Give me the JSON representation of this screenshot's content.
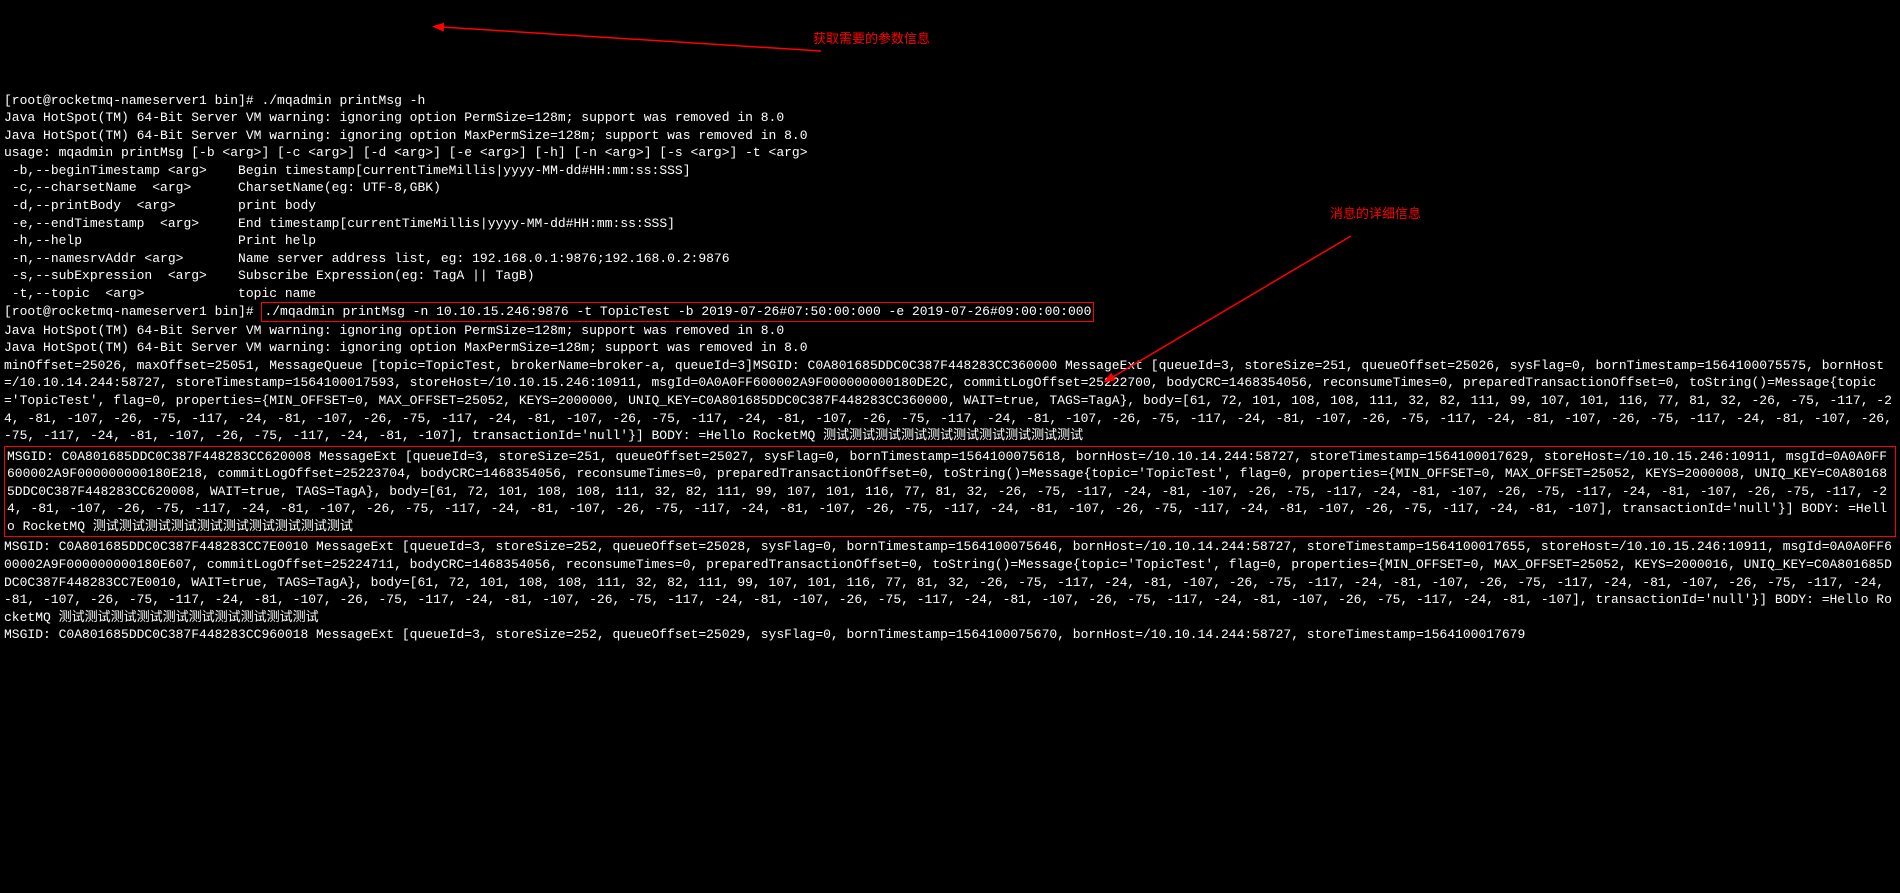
{
  "prompt1": {
    "userhost": "[root@rocketmq-nameserver1 bin]# ",
    "cmd": "./mqadmin printMsg -h"
  },
  "warn1": "Java HotSpot(TM) 64-Bit Server VM warning: ignoring option PermSize=128m; support was removed in 8.0",
  "warn2": "Java HotSpot(TM) 64-Bit Server VM warning: ignoring option MaxPermSize=128m; support was removed in 8.0",
  "usage": "usage: mqadmin printMsg [-b <arg>] [-c <arg>] [-d <arg>] [-e <arg>] [-h] [-n <arg>] [-s <arg>] -t <arg>",
  "opts": {
    "b": " -b,--beginTimestamp <arg>    Begin timestamp[currentTimeMillis|yyyy-MM-dd#HH:mm:ss:SSS]",
    "c": " -c,--charsetName  <arg>      CharsetName(eg: UTF-8,GBK)",
    "d": " -d,--printBody  <arg>        print body",
    "e": " -e,--endTimestamp  <arg>     End timestamp[currentTimeMillis|yyyy-MM-dd#HH:mm:ss:SSS]",
    "h": " -h,--help                    Print help",
    "n": " -n,--namesrvAddr <arg>       Name server address list, eg: 192.168.0.1:9876;192.168.0.2:9876",
    "s": " -s,--subExpression  <arg>    Subscribe Expression(eg: TagA || TagB)",
    "t": " -t,--topic  <arg>            topic name"
  },
  "prompt2": {
    "userhost": "[root@rocketmq-nameserver1 bin]# ",
    "cmd": "./mqadmin printMsg -n 10.10.15.246:9876 -t TopicTest -b 2019-07-26#07:50:00:000 -e 2019-07-26#09:00:00:000"
  },
  "warn3": "Java HotSpot(TM) 64-Bit Server VM warning: ignoring option PermSize=128m; support was removed in 8.0",
  "warn4": "Java HotSpot(TM) 64-Bit Server VM warning: ignoring option MaxPermSize=128m; support was removed in 8.0",
  "msg1": "minOffset=25026, maxOffset=25051, MessageQueue [topic=TopicTest, brokerName=broker-a, queueId=3]MSGID: C0A801685DDC0C387F448283CC360000 MessageExt [queueId=3, storeSize=251, queueOffset=25026, sysFlag=0, bornTimestamp=1564100075575, bornHost=/10.10.14.244:58727, storeTimestamp=1564100017593, storeHost=/10.10.15.246:10911, msgId=0A0A0FF600002A9F000000000180DE2C, commitLogOffset=25222700, bodyCRC=1468354056, reconsumeTimes=0, preparedTransactionOffset=0, toString()=Message{topic='TopicTest', flag=0, properties={MIN_OFFSET=0, MAX_OFFSET=25052, KEYS=2000000, UNIQ_KEY=C0A801685DDC0C387F448283CC360000, WAIT=true, TAGS=TagA}, body=[61, 72, 101, 108, 108, 111, 32, 82, 111, 99, 107, 101, 116, 77, 81, 32, -26, -75, -117, -24, -81, -107, -26, -75, -117, -24, -81, -107, -26, -75, -117, -24, -81, -107, -26, -75, -117, -24, -81, -107, -26, -75, -117, -24, -81, -107, -26, -75, -117, -24, -81, -107, -26, -75, -117, -24, -81, -107, -26, -75, -117, -24, -81, -107, -26, -75, -117, -24, -81, -107, -26, -75, -117, -24, -81, -107], transactionId='null'}] BODY: =Hello RocketMQ 测试测试测试测试测试测试测试测试测试测试",
  "msg2": "MSGID: C0A801685DDC0C387F448283CC620008 MessageExt [queueId=3, storeSize=251, queueOffset=25027, sysFlag=0, bornTimestamp=1564100075618, bornHost=/10.10.14.244:58727, storeTimestamp=1564100017629, storeHost=/10.10.15.246:10911, msgId=0A0A0FF600002A9F000000000180E218, commitLogOffset=25223704, bodyCRC=1468354056, reconsumeTimes=0, preparedTransactionOffset=0, toString()=Message{topic='TopicTest', flag=0, properties={MIN_OFFSET=0, MAX_OFFSET=25052, KEYS=2000008, UNIQ_KEY=C0A801685DDC0C387F448283CC620008, WAIT=true, TAGS=TagA}, body=[61, 72, 101, 108, 108, 111, 32, 82, 111, 99, 107, 101, 116, 77, 81, 32, -26, -75, -117, -24, -81, -107, -26, -75, -117, -24, -81, -107, -26, -75, -117, -24, -81, -107, -26, -75, -117, -24, -81, -107, -26, -75, -117, -24, -81, -107, -26, -75, -117, -24, -81, -107, -26, -75, -117, -24, -81, -107, -26, -75, -117, -24, -81, -107, -26, -75, -117, -24, -81, -107, -26, -75, -117, -24, -81, -107], transactionId='null'}] BODY: =Hello RocketMQ 测试测试测试测试测试测试测试测试测试测试",
  "msg3": "MSGID: C0A801685DDC0C387F448283CC7E0010 MessageExt [queueId=3, storeSize=252, queueOffset=25028, sysFlag=0, bornTimestamp=1564100075646, bornHost=/10.10.14.244:58727, storeTimestamp=1564100017655, storeHost=/10.10.15.246:10911, msgId=0A0A0FF600002A9F000000000180E607, commitLogOffset=25224711, bodyCRC=1468354056, reconsumeTimes=0, preparedTransactionOffset=0, toString()=Message{topic='TopicTest', flag=0, properties={MIN_OFFSET=0, MAX_OFFSET=25052, KEYS=2000016, UNIQ_KEY=C0A801685DDC0C387F448283CC7E0010, WAIT=true, TAGS=TagA}, body=[61, 72, 101, 108, 108, 111, 32, 82, 111, 99, 107, 101, 116, 77, 81, 32, -26, -75, -117, -24, -81, -107, -26, -75, -117, -24, -81, -107, -26, -75, -117, -24, -81, -107, -26, -75, -117, -24, -81, -107, -26, -75, -117, -24, -81, -107, -26, -75, -117, -24, -81, -107, -26, -75, -117, -24, -81, -107, -26, -75, -117, -24, -81, -107, -26, -75, -117, -24, -81, -107, -26, -75, -117, -24, -81, -107], transactionId='null'}] BODY: =Hello RocketMQ 测试测试测试测试测试测试测试测试测试测试",
  "msg4": "MSGID: C0A801685DDC0C387F448283CC960018 MessageExt [queueId=3, storeSize=252, queueOffset=25029, sysFlag=0, bornTimestamp=1564100075670, bornHost=/10.10.14.244:58727, storeTimestamp=1564100017679",
  "annotations": {
    "params": "获取需要的参数信息",
    "msgdetail": "消息的详细信息"
  }
}
